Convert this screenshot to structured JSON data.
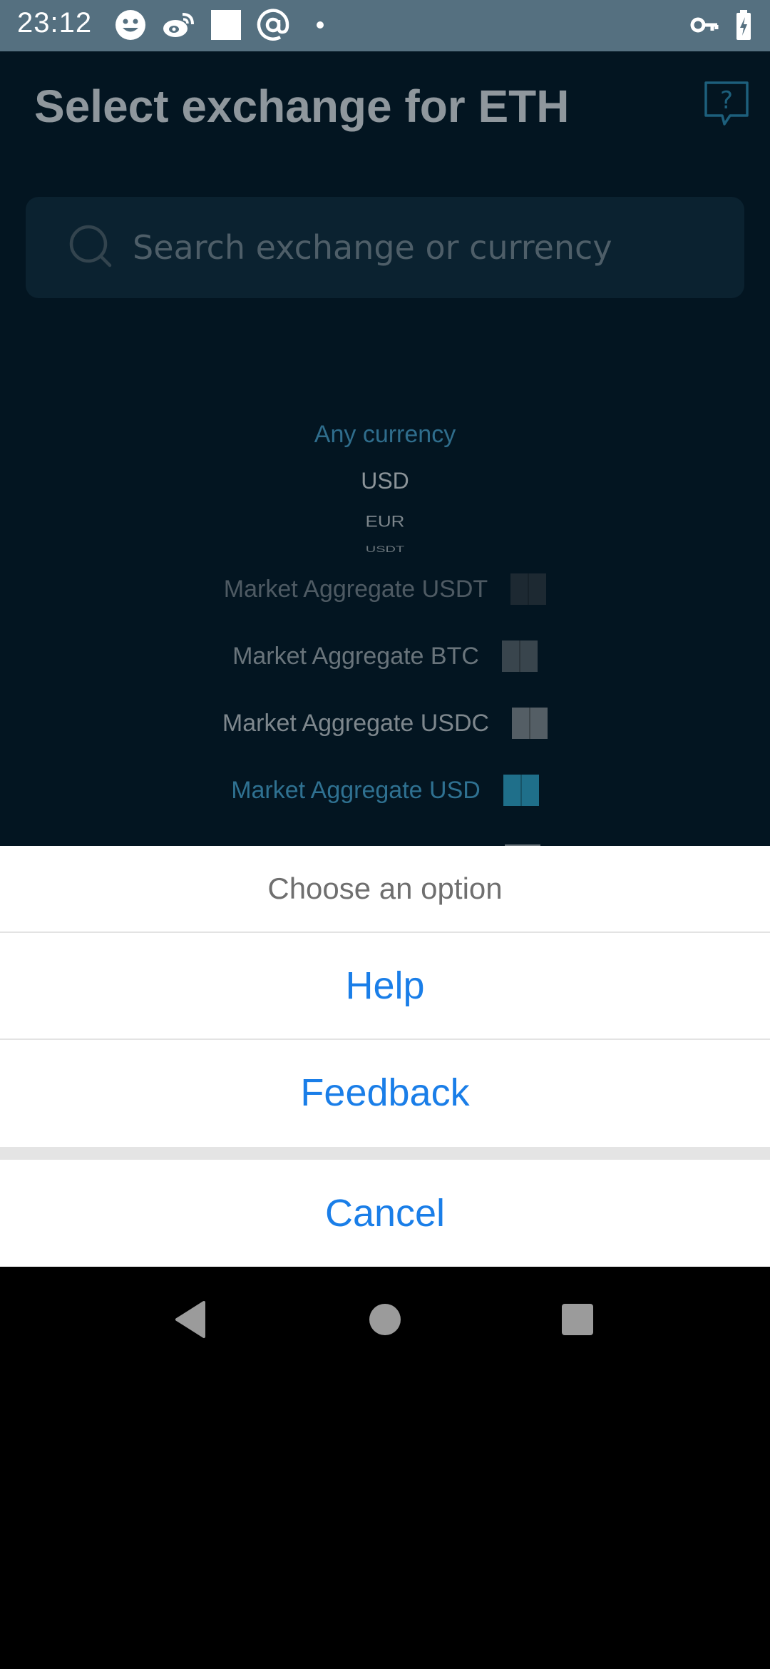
{
  "status_bar": {
    "time": "23:12",
    "icons": [
      "smiley-icon",
      "weibo-icon",
      "square-icon",
      "at-sign-icon",
      "dot-icon",
      "key-icon",
      "battery-charging-icon"
    ]
  },
  "header": {
    "title": "Select exchange for ETH",
    "help_icon": "question-message-icon"
  },
  "search": {
    "placeholder": "Search exchange or currency",
    "value": ""
  },
  "currency_picker": {
    "options": [
      "Any currency",
      "USD",
      "EUR",
      "USDT"
    ],
    "selected": "Any currency"
  },
  "markets": [
    {
      "label": "Market Aggregate USDT",
      "color": "#333b41",
      "opacity": 0.55
    },
    {
      "label": "Market Aggregate BTC",
      "color": "#4c565c",
      "opacity": 0.75
    },
    {
      "label": "Market Aggregate USDC",
      "color": "#5d676d",
      "opacity": 0.9
    },
    {
      "label": "Market Aggregate USD",
      "color": "#1f6f8a",
      "opacity": 1.0,
      "label_color": "#2f7191"
    }
  ],
  "sheet": {
    "title": "Choose an option",
    "help_label": "Help",
    "feedback_label": "Feedback",
    "cancel_label": "Cancel"
  },
  "colors": {
    "accent": "#1a7ee8",
    "status_bar": "#557080",
    "app_background": "#031521"
  }
}
